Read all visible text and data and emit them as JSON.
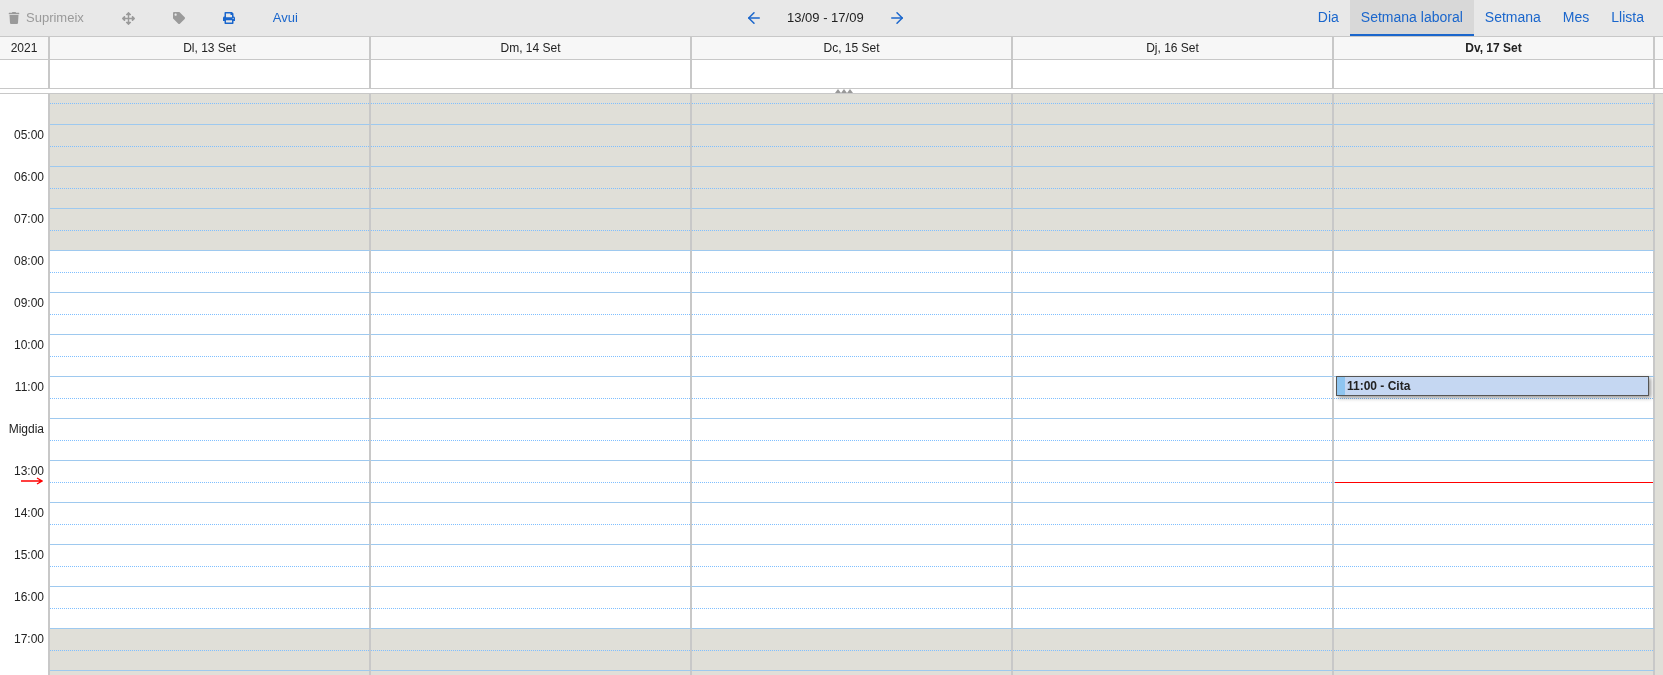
{
  "toolbar": {
    "actions": [
      {
        "kind": "delete",
        "label": "Suprimeix",
        "disabled": true
      },
      {
        "kind": "move",
        "disabled": true
      },
      {
        "kind": "tag",
        "disabled": true
      },
      {
        "kind": "print",
        "disabled": false
      },
      {
        "kind": "today",
        "label": "Avui",
        "disabled": false
      }
    ]
  },
  "navigation": {
    "range": "13/09 - 17/09"
  },
  "views": [
    {
      "label": "Dia",
      "selected": false
    },
    {
      "label": "Setmana laboral",
      "selected": true
    },
    {
      "label": "Setmana",
      "selected": false
    },
    {
      "label": "Mes",
      "selected": false
    },
    {
      "label": "Llista",
      "selected": false
    }
  ],
  "calendar": {
    "year": "2021",
    "days": [
      {
        "label": "Dl, 13 Set",
        "today": false
      },
      {
        "label": "Dm, 14 Set",
        "today": false
      },
      {
        "label": "Dc, 15 Set",
        "today": false
      },
      {
        "label": "Dj, 16 Set",
        "today": false
      },
      {
        "label": "Dv, 17 Set",
        "today": true,
        "events": [
          {
            "title": "11:00 - Cita"
          }
        ]
      }
    ],
    "hours": [
      {
        "kind": "partial",
        "off_hours": true
      },
      {
        "kind": "hour",
        "label": "05:00",
        "off_hours": true
      },
      {
        "kind": "hour",
        "label": "06:00",
        "off_hours": true
      },
      {
        "kind": "hour",
        "label": "07:00",
        "off_hours": true
      },
      {
        "kind": "hour",
        "label": "08:00",
        "off_hours": false
      },
      {
        "kind": "hour",
        "label": "09:00",
        "off_hours": false
      },
      {
        "kind": "hour",
        "label": "10:00",
        "off_hours": false
      },
      {
        "kind": "hour",
        "label": "11:00",
        "off_hours": false,
        "event_start": true
      },
      {
        "kind": "hour",
        "label": "Migdia",
        "off_hours": false
      },
      {
        "kind": "hour",
        "label": "13:00",
        "off_hours": false,
        "now_marker": true
      },
      {
        "kind": "hour",
        "label": "14:00",
        "off_hours": false
      },
      {
        "kind": "hour",
        "label": "15:00",
        "off_hours": false
      },
      {
        "kind": "hour",
        "label": "16:00",
        "off_hours": false
      },
      {
        "kind": "hour",
        "label": "17:00",
        "off_hours": true
      },
      {
        "kind": "hour",
        "off_hours": true
      }
    ]
  }
}
